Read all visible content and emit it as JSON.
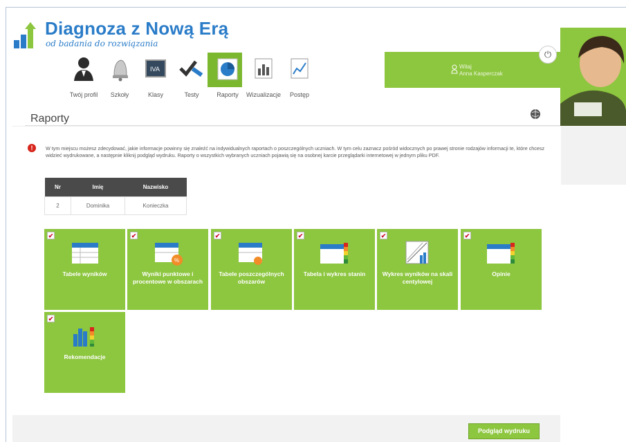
{
  "brand": {
    "title": "Diagnoza z Nową Erą",
    "subtitle": "od badania do rozwiązania"
  },
  "nav": {
    "items": [
      {
        "label": "Twój profil",
        "icon": "profile-icon"
      },
      {
        "label": "Szkoły",
        "icon": "bell-icon"
      },
      {
        "label": "Klasy",
        "icon": "class-board-icon"
      },
      {
        "label": "Testy",
        "icon": "tests-check-icon"
      },
      {
        "label": "Raporty",
        "icon": "reports-pie-icon",
        "active": true
      },
      {
        "label": "Wizualizacje",
        "icon": "visualization-chart-icon"
      },
      {
        "label": "Postęp",
        "icon": "progress-chart-icon"
      }
    ]
  },
  "user": {
    "greeting": "Witaj",
    "name": "Anna Kasperczak"
  },
  "page": {
    "title": "Raporty"
  },
  "info": {
    "text": "W tym miejscu możesz zdecydować, jakie informacje powinny się znaleźć na indywidualnych raportach o poszczególnych uczniach. W tym celu zaznacz pośród widocznych po prawej stronie rodzajów informacji te, które chcesz widzieć wydrukowane, a następnie kliknij podgląd wydruku. Raporty o wszystkich wybranych uczniach pojawią się na osobnej karcie przeglądarki internetowej w jednym pliku PDF."
  },
  "table": {
    "headers": [
      "Nr",
      "Imię",
      "Nazwisko"
    ],
    "rows": [
      [
        "2",
        "Dominika",
        "Konieczka"
      ]
    ]
  },
  "tiles": [
    {
      "label": "Tabele wyników",
      "icon": "table-icon",
      "checked": true
    },
    {
      "label": "Wyniki punktowe i procentowe w obszarach",
      "icon": "table-percent-icon",
      "checked": true
    },
    {
      "label": "Tabele poszczególnych obszarów",
      "icon": "table-area-icon",
      "checked": true
    },
    {
      "label": "Tabela i wykres stanin",
      "icon": "table-stanine-icon",
      "checked": true
    },
    {
      "label": "Wykres wyników na skali centylowej",
      "icon": "centile-chart-icon",
      "checked": true
    },
    {
      "label": "Opinie",
      "icon": "opinions-icon",
      "checked": true
    },
    {
      "label": "Rekomendacje",
      "icon": "recommendations-chart-icon",
      "checked": true
    }
  ],
  "actions": {
    "print_preview": "Podgląd wydruku"
  },
  "colors": {
    "brand_blue": "#2a7cc8",
    "green": "#8dc63f",
    "green_dark": "#7cb82f",
    "alert_red": "#d8261c"
  }
}
